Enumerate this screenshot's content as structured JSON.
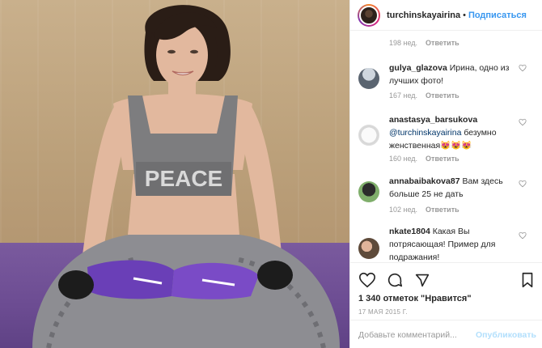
{
  "post": {
    "username": "turchinskayairina",
    "separator": "•",
    "follow_label": "Подписаться"
  },
  "comments": {
    "first_meta": {
      "time": "198 нед.",
      "reply": "Ответить"
    },
    "items": [
      {
        "user": "gulya_glazova",
        "text": "Ирина, одно из лучших фото!",
        "mention": "",
        "time": "167 нед.",
        "reply": "Ответить"
      },
      {
        "user": "anastasya_barsukova",
        "mention": "@turchinskayairina",
        "text": "безумно женственная😻😻😻",
        "time": "160 нед.",
        "reply": "Ответить"
      },
      {
        "user": "annabaibakova87",
        "text": "Вам здесь больше 25 не дать",
        "mention": "",
        "time": "102 нед.",
        "reply": "Ответить"
      },
      {
        "user": "nkate1804",
        "text": "Какая Вы потрясающая! Пример для подражания!",
        "mention": "",
        "time": "",
        "reply": ""
      }
    ]
  },
  "actions": {
    "likes_text": "1 340 отметок \"Нравится\"",
    "date": "17 МАЯ 2015 Г.",
    "comment_placeholder": "Добавьте комментарий...",
    "publish_label": "Опубликовать"
  },
  "photo": {
    "shirt_text": "PEACE"
  },
  "colors": {
    "accent": "#3897f0",
    "publish_disabled": "#b2dffc",
    "muted": "#999999",
    "mat": "#6c4c92"
  },
  "icons": [
    "heart-icon",
    "comment-icon",
    "share-icon",
    "bookmark-icon"
  ]
}
